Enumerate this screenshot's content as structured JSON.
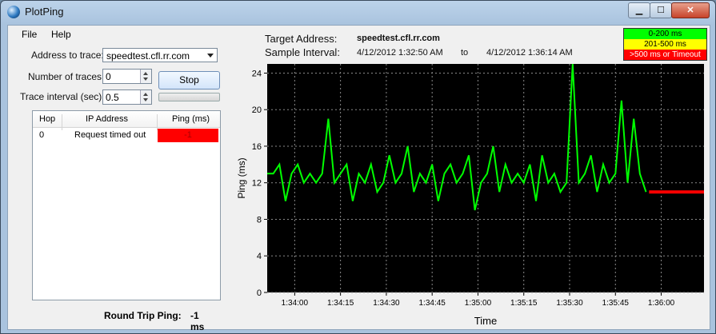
{
  "window": {
    "title": "PlotPing",
    "close_glyph": "✕",
    "max_glyph": "☐",
    "min_glyph": "▁"
  },
  "menu": {
    "file": "File",
    "help": "Help"
  },
  "controls": {
    "address_label": "Address to trace:",
    "address_value": "speedtest.cfl.rr.com",
    "traces_label": "Number of traces:",
    "traces_value": "0",
    "interval_label": "Trace interval (sec):",
    "interval_value": "0.5",
    "stop_label": "Stop"
  },
  "table": {
    "columns": [
      "Hop",
      "IP Address",
      "Ping (ms)"
    ],
    "rows": [
      {
        "hop": "0",
        "ip": "Request timed out",
        "ping": "-1"
      }
    ]
  },
  "round_trip": {
    "label": "Round Trip Ping:",
    "value": "-1 ms"
  },
  "header": {
    "target_label": "Target Address:",
    "target_value": "speedtest.cfl.rr.com",
    "interval_label": "Sample Interval:",
    "interval_start": "4/12/2012 1:32:50 AM",
    "to": "to",
    "interval_end": "4/12/2012 1:36:14 AM"
  },
  "legend": [
    {
      "label": "0-200 ms",
      "color": "#00ff00"
    },
    {
      "label": "201-500 ms",
      "color": "#ffff00"
    },
    {
      "label": ">500 ms or Timeout",
      "color": "#ff0000"
    }
  ],
  "chart_data": {
    "type": "line",
    "xlabel": "Time",
    "ylabel": "Ping (ms)",
    "ylim": [
      0,
      25
    ],
    "yticks": [
      0,
      4,
      8,
      12,
      16,
      20,
      24
    ],
    "xrange": [
      "1:33:51",
      "1:36:14"
    ],
    "xticks": [
      "1:34:00",
      "1:34:15",
      "1:34:30",
      "1:34:45",
      "1:35:00",
      "1:35:15",
      "1:35:30",
      "1:35:45",
      "1:36:00"
    ],
    "grid": true,
    "background": "#000000",
    "series": [
      {
        "color": "#00ff00",
        "x": [
          "1:33:51",
          "1:33:53",
          "1:33:55",
          "1:33:57",
          "1:33:59",
          "1:34:01",
          "1:34:03",
          "1:34:05",
          "1:34:07",
          "1:34:09",
          "1:34:11",
          "1:34:13",
          "1:34:15",
          "1:34:17",
          "1:34:19",
          "1:34:21",
          "1:34:23",
          "1:34:25",
          "1:34:27",
          "1:34:29",
          "1:34:31",
          "1:34:33",
          "1:34:35",
          "1:34:37",
          "1:34:39",
          "1:34:41",
          "1:34:43",
          "1:34:45",
          "1:34:47",
          "1:34:49",
          "1:34:51",
          "1:34:53",
          "1:34:55",
          "1:34:57",
          "1:34:59",
          "1:35:01",
          "1:35:03",
          "1:35:05",
          "1:35:07",
          "1:35:09",
          "1:35:11",
          "1:35:13",
          "1:35:15",
          "1:35:17",
          "1:35:19",
          "1:35:21",
          "1:35:23",
          "1:35:25",
          "1:35:27",
          "1:35:29",
          "1:35:31",
          "1:35:33",
          "1:35:35",
          "1:35:37",
          "1:35:39",
          "1:35:41",
          "1:35:43",
          "1:35:45",
          "1:35:47",
          "1:35:49",
          "1:35:51",
          "1:35:53",
          "1:35:55"
        ],
        "y": [
          13,
          13,
          14,
          10,
          13,
          14,
          12,
          13,
          12,
          13,
          19,
          12,
          13,
          14,
          10,
          13,
          12,
          14,
          11,
          12,
          15,
          12,
          13,
          16,
          11,
          13,
          12,
          14,
          10,
          13,
          14,
          12,
          13,
          15,
          9,
          12,
          13,
          16,
          11,
          14,
          12,
          13,
          12,
          14,
          10,
          15,
          12,
          13,
          11,
          12,
          25,
          12,
          13,
          15,
          11,
          14,
          12,
          13,
          21,
          12,
          19,
          13,
          11
        ]
      },
      {
        "color": "#ff0000",
        "x": [
          "1:35:56",
          "1:36:14"
        ],
        "y": [
          11,
          11
        ]
      }
    ]
  }
}
